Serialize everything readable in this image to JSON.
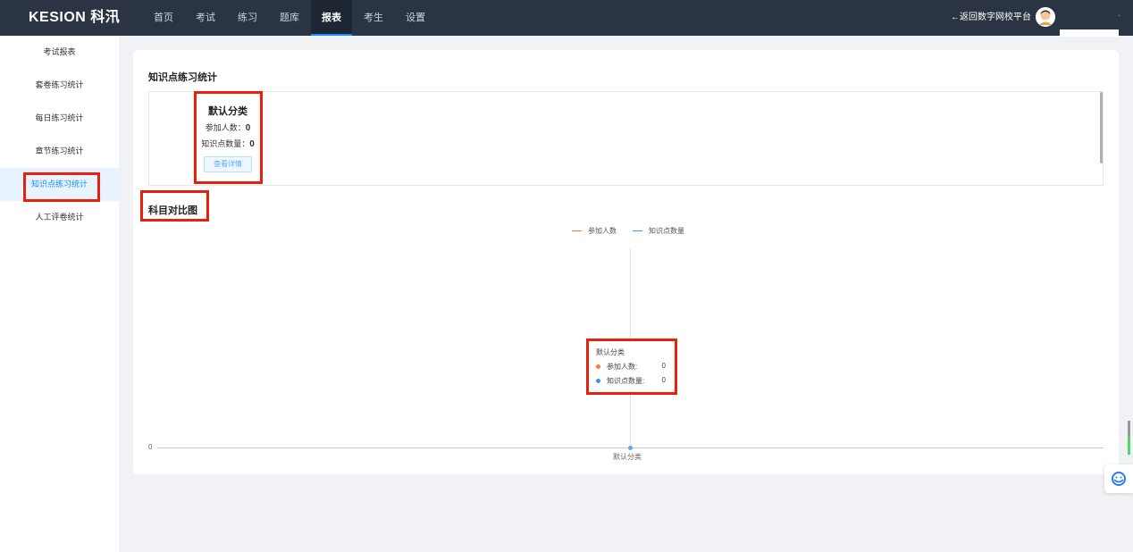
{
  "header": {
    "logo": "KESION 科汛",
    "nav": [
      "首页",
      "考试",
      "练习",
      "题库",
      "报表",
      "考生",
      "设置"
    ],
    "active_nav": "报表",
    "back_link": "←返回数字网校平台",
    "more_symbol": "·"
  },
  "sidebar": {
    "items": [
      {
        "label": "考试报表"
      },
      {
        "label": "套卷练习统计"
      },
      {
        "label": "每日练习统计"
      },
      {
        "label": "章节练习统计"
      },
      {
        "label": "知识点练习统计"
      },
      {
        "label": "人工评卷统计"
      }
    ],
    "active": "知识点练习统计"
  },
  "main": {
    "title": "知识点练习统计",
    "category": {
      "name": "默认分类",
      "participants_label": "参加人数：",
      "participants_value": "0",
      "knowledge_label": "知识点数量：",
      "knowledge_value": "0",
      "detail_button": "查看详情"
    },
    "chart_section_title": "科目对比图"
  },
  "chart_data": {
    "type": "line",
    "title": "",
    "categories": [
      "默认分类"
    ],
    "series": [
      {
        "name": "参加人数",
        "values": [
          0
        ],
        "color": "#f57a32"
      },
      {
        "name": "知识点数量",
        "values": [
          0
        ],
        "color": "#3d94f6"
      }
    ],
    "y_ticks": [
      "0"
    ],
    "legend_position": "top-center",
    "tooltip": {
      "title": "默认分类",
      "rows": [
        {
          "label": "参加人数:",
          "value": "0",
          "color": "#f57a32"
        },
        {
          "label": "知识点数量:",
          "value": "0",
          "color": "#3d94f6"
        }
      ]
    }
  }
}
